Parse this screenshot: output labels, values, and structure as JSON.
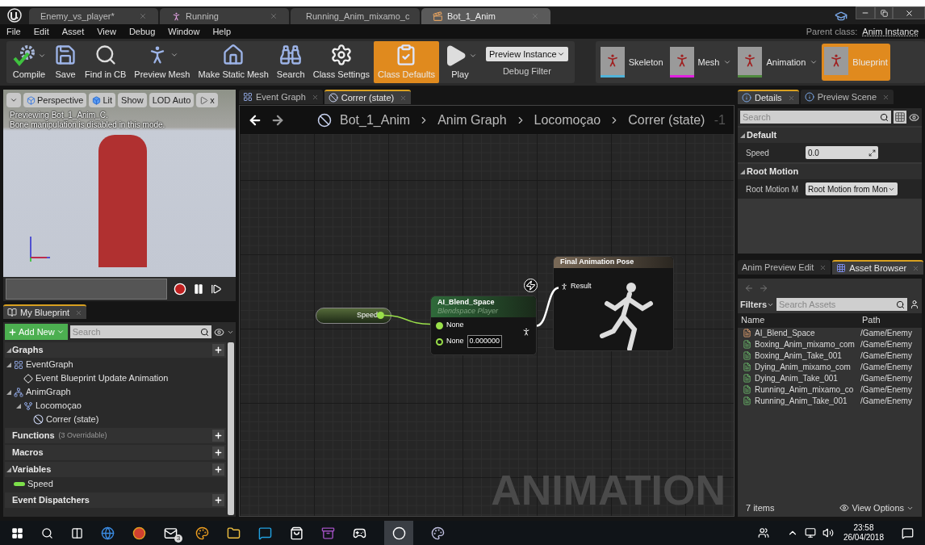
{
  "title_bar": {
    "tabs": [
      {
        "label": "Enemy_vs_player*",
        "selected": false,
        "kind": "level"
      },
      {
        "label": "Running",
        "selected": false,
        "kind": "animation"
      },
      {
        "label": "Running_Anim_mixamo_c",
        "selected": false,
        "kind": "sequence"
      },
      {
        "label": "Bot_1_Anim",
        "selected": true,
        "kind": "blueprint"
      }
    ]
  },
  "menu": [
    "File",
    "Edit",
    "Asset",
    "View",
    "Debug",
    "Window",
    "Help"
  ],
  "parent_class": {
    "label": "Parent class:",
    "value": "Anim Instance"
  },
  "toolbar": [
    {
      "label": "Compile",
      "kind": "compile",
      "selected": false,
      "dropdown": true
    },
    {
      "label": "Save",
      "kind": "save",
      "selected": false,
      "dropdown": false
    },
    {
      "label": "Find in CB",
      "kind": "find",
      "selected": false,
      "dropdown": false
    },
    {
      "label": "Preview Mesh",
      "kind": "mesh",
      "selected": false,
      "dropdown": true
    },
    {
      "label": "Make Static Mesh",
      "kind": "static",
      "selected": false,
      "dropdown": false
    },
    {
      "label": "Search",
      "kind": "search",
      "selected": false,
      "dropdown": false
    },
    {
      "label": "Class Settings",
      "kind": "settings",
      "selected": false,
      "dropdown": false
    },
    {
      "label": "Class Defaults",
      "kind": "defaults",
      "selected": true,
      "dropdown": false
    },
    {
      "label": "Play",
      "kind": "play",
      "selected": false,
      "dropdown": true
    }
  ],
  "debug_filter": {
    "value": "Preview Instance",
    "label": "Debug Filter"
  },
  "modes": [
    {
      "label": "Skeleton",
      "selected": false,
      "dropdown": false,
      "color": "#4fb3d9"
    },
    {
      "label": "Mesh",
      "selected": false,
      "dropdown": true,
      "color": "#e020e0"
    },
    {
      "label": "Animation",
      "selected": false,
      "dropdown": true,
      "color": "#4f8a3f"
    },
    {
      "label": "Blueprint",
      "selected": true,
      "dropdown": false,
      "color": "#e08a1e"
    }
  ],
  "viewport": {
    "buttons": [
      {
        "label": "Perspective",
        "kind": "perspective"
      },
      {
        "label": "Lit",
        "kind": "lit"
      },
      {
        "label": "Show",
        "kind": "plain"
      },
      {
        "label": "LOD Auto",
        "kind": "plain"
      },
      {
        "label": "x",
        "kind": "speed"
      }
    ],
    "overlay": [
      "Previewing Bot_1_Anim_C.",
      "Bone manipulation is disabled in this mode."
    ]
  },
  "my_blueprint": {
    "tab": "My Blueprint",
    "add_new": "Add New",
    "search_placeholder": "Search",
    "sections": [
      {
        "title": "Graphs",
        "items": [
          {
            "label": "EventGraph",
            "kind": "event_graph",
            "children": [
              {
                "label": "Event Blueprint Update Animation",
                "kind": "event"
              }
            ]
          },
          {
            "label": "AnimGraph",
            "kind": "anim_graph",
            "children": [
              {
                "label": "Locomoçao",
                "kind": "state_machine",
                "children": [
                  {
                    "label": "Correr (state)",
                    "kind": "state"
                  }
                ]
              }
            ]
          }
        ]
      },
      {
        "title": "Functions",
        "note": "(3 Overridable)"
      },
      {
        "title": "Macros"
      },
      {
        "title": "Variables",
        "items": [
          {
            "label": "Speed",
            "kind": "variable"
          }
        ]
      },
      {
        "title": "Event Dispatchers"
      }
    ]
  },
  "graph_editor": {
    "tabs": [
      {
        "label": "Event Graph",
        "selected": false,
        "kind": "graph"
      },
      {
        "label": "Correr (state)",
        "selected": true,
        "kind": "state"
      }
    ],
    "breadcrumb": [
      "Bot_1_Anim",
      "Anim Graph",
      "Locomoçao",
      "Correr (state)"
    ],
    "zoom": "-1",
    "speed_node": {
      "label": "Speed"
    },
    "blend_node": {
      "title": "AI_Blend_Space",
      "subtitle": "Blendspace Player",
      "pins": [
        {
          "label": "None",
          "connected": true
        },
        {
          "label": "None",
          "connected": false,
          "value": "0.000000"
        }
      ]
    },
    "result_node": {
      "title": "Final Animation Pose",
      "pin": "Result"
    },
    "watermark": "ANIMATION"
  },
  "details": {
    "tabs": [
      {
        "label": "Details",
        "selected": true
      },
      {
        "label": "Preview Scene",
        "selected": false
      }
    ],
    "search_placeholder": "Search",
    "sections": [
      {
        "title": "Default",
        "rows": [
          {
            "label": "Speed",
            "value": "0.0",
            "kind": "number"
          }
        ]
      },
      {
        "title": "Root Motion",
        "rows": [
          {
            "label": "Root Motion M",
            "value": "Root Motion from Mon",
            "kind": "dropdown"
          }
        ]
      }
    ]
  },
  "asset_browser": {
    "tabs": [
      {
        "label": "Anim Preview Edit",
        "selected": false
      },
      {
        "label": "Asset Browser",
        "selected": true
      }
    ],
    "filters": "Filters",
    "search_placeholder": "Search Assets",
    "columns": [
      "Name",
      "Path"
    ],
    "rows": [
      {
        "name": "AI_Blend_Space",
        "path": "/Game/Enemy",
        "kind": "blendspace"
      },
      {
        "name": "Boxing_Anim_mixamo_com",
        "path": "/Game/Enemy",
        "kind": "sequence"
      },
      {
        "name": "Boxing_Anim_Take_001",
        "path": "/Game/Enemy",
        "kind": "sequence"
      },
      {
        "name": "Dying_Anim_mixamo_com",
        "path": "/Game/Enemy",
        "kind": "sequence"
      },
      {
        "name": "Dying_Anim_Take_001",
        "path": "/Game/Enemy",
        "kind": "sequence"
      },
      {
        "name": "Running_Anim_mixamo_co",
        "path": "/Game/Enemy",
        "kind": "sequence"
      },
      {
        "name": "Running_Anim_Take_001",
        "path": "/Game/Enemy",
        "kind": "sequence"
      }
    ],
    "count": "7 items",
    "view_options": "View Options"
  },
  "taskbar": {
    "mail_badge": "3",
    "time": "23:58",
    "date": "26/04/2018"
  }
}
